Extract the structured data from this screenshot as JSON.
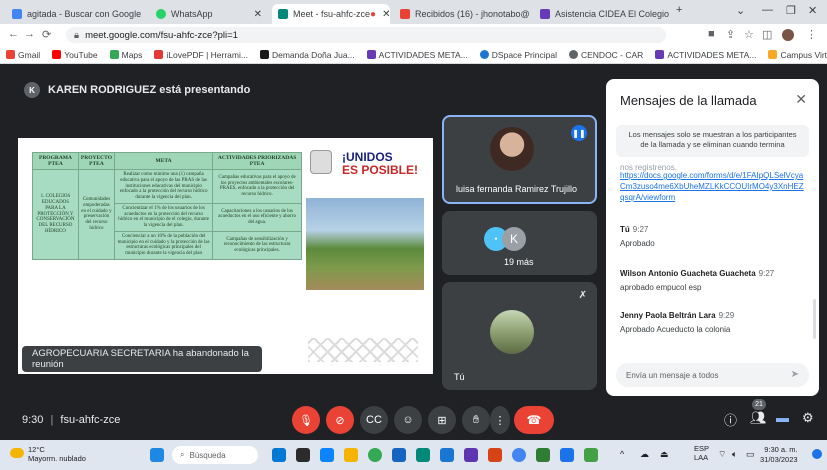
{
  "browser": {
    "tabs": [
      {
        "title": "agitada - Buscar con Google",
        "active": false,
        "color": "#4285f4"
      },
      {
        "title": "WhatsApp",
        "active": false,
        "color": "#25d366"
      },
      {
        "title": "Meet - fsu-ahfc-zce",
        "active": true,
        "color": "#00897b"
      },
      {
        "title": "Recibidos (16) - jhonotabo@",
        "active": false,
        "color": "#ea4335"
      },
      {
        "title": "Asistencia CIDEA El Colegio",
        "active": false,
        "color": "#673ab7"
      }
    ],
    "url": "meet.google.com/fsu-ahfc-zce?pli=1",
    "bookmarks": [
      "Gmail",
      "YouTube",
      "Maps",
      "iLovePDF | Herrami...",
      "Demanda Doña Jua...",
      "ACTIVIDADES META...",
      "DSpace Principal",
      "CENDOC - CAR",
      "ACTIVIDADES META...",
      "Campus Virtual UM..."
    ]
  },
  "meet": {
    "presenter_initial": "K",
    "presenter_banner": "KAREN RODRIGUEZ está presentando",
    "toast": "AGROPECUARIA SECRETARIA ha abandonado la reunión",
    "slide": {
      "headers": [
        "PROGRAMA PTEA",
        "PROYECTO PTEA",
        "META",
        "ACTIVIDADES PRIORIZADAS PTEA"
      ],
      "programa": "1. COLEGIOS EDUCADOS PARA LA PROTECCIÓN Y CONSERVACIÓN DEL RECURSO HÍDRICO",
      "proyecto": "Comunidades empoderadas en el cuidado y preservación del recurso hídrico",
      "rows": [
        {
          "meta": "Realizar como mínimo una (1) campaña educativa para el apoyo de las PRAS de las instituciones educativas del municipio enfocado a la protección del recurso hídrico durante la vigencia del plan.",
          "actividad": "Campañas educativas para el apoyo de los proyectos ambientales escolares-PRAES, enfocado a la protección del recurso hídrico."
        },
        {
          "meta": "Concientizar el 1% de los usuarios de los acueductos en la protección del recurso hídrico en el municipio de el colegio, durante la vigencia del plan.",
          "actividad": "Capacitaciones a los usuarios de los acueductos en el uso eficiente y ahorro del agua."
        },
        {
          "meta": "Concienciar a un 10% de la población del municipio en el cuidado y la protección de las estructuras ecológicas principales del municipio durante la vigencia del plan",
          "actividad": "Campañas de sensibilización y reconocimiento de las estructuras ecológicas principales."
        }
      ],
      "logo_line1": "¡UNIDOS",
      "logo_line2": "ES POSIBLE!"
    },
    "tiles": {
      "speaker_name": "luisa fernanda Ramirez Trujillo",
      "others_initial": "K",
      "others_count": "19 más",
      "self_name": "Tú"
    },
    "chat": {
      "title": "Mensajes de la llamada",
      "note": "Los mensajes solo se muestran a los participantes de la llamada y se eliminan cuando termina",
      "partial_top": "nos registrenos.",
      "link": "https://docs.google.com/forms/d/e/1FAIpQLSelVcyaCm3zuso4me6XbUheMZLKkCCOUIrMO4y3XnHEZqsqrA/viewform",
      "messages": [
        {
          "sender": "Tú",
          "time": "9:27",
          "text": "Aprobado"
        },
        {
          "sender": "Wilson Antonio Guacheta Guacheta",
          "time": "9:27",
          "text": "aprobado empucol esp"
        },
        {
          "sender": "Jenny Paola Beltrán Lara",
          "time": "9:29",
          "text": "Aprobado Acueducto la colonia"
        }
      ],
      "input_placeholder": "Envía un mensaje a todos"
    },
    "bottom": {
      "time": "9:30",
      "separator": "|",
      "code": "fsu-ahfc-zce",
      "participants_badge": "21"
    }
  },
  "taskbar": {
    "temperature": "12°C",
    "weather": "Mayorm. nublado",
    "search": "Búsqueda",
    "lang1": "ESP",
    "lang2": "LAA",
    "time": "9:30 a. m.",
    "date": "31/03/2023"
  }
}
